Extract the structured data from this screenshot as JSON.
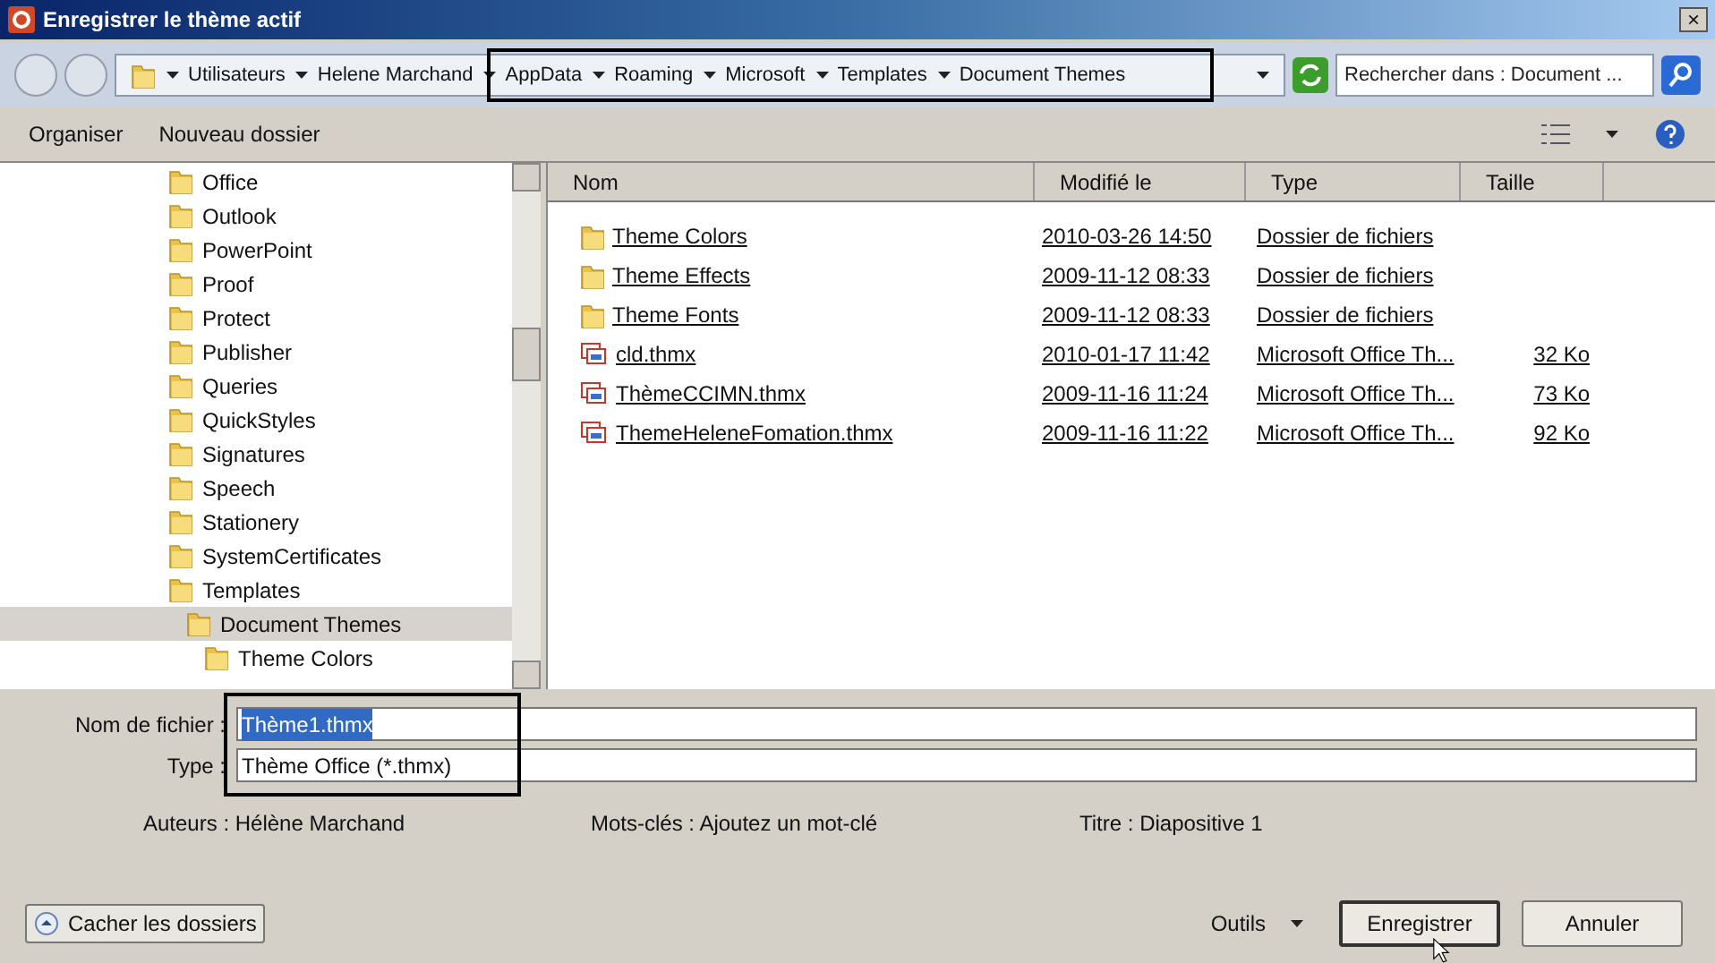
{
  "window": {
    "title": "Enregistrer le thème actif",
    "close": "×"
  },
  "breadcrumb": [
    {
      "label": "Utilisateurs"
    },
    {
      "label": "Helene Marchand"
    },
    {
      "label": "AppData"
    },
    {
      "label": "Roaming"
    },
    {
      "label": "Microsoft"
    },
    {
      "label": "Templates"
    },
    {
      "label": "Document Themes"
    }
  ],
  "search": {
    "placeholder": "Rechercher dans : Document ..."
  },
  "toolbar": {
    "organize": "Organiser",
    "new_folder": "Nouveau dossier"
  },
  "tree": [
    {
      "label": "Office",
      "selected": false
    },
    {
      "label": "Outlook",
      "selected": false
    },
    {
      "label": "PowerPoint",
      "selected": false
    },
    {
      "label": "Proof",
      "selected": false
    },
    {
      "label": "Protect",
      "selected": false
    },
    {
      "label": "Publisher",
      "selected": false
    },
    {
      "label": "Queries",
      "selected": false
    },
    {
      "label": "QuickStyles",
      "selected": false
    },
    {
      "label": "Signatures",
      "selected": false
    },
    {
      "label": "Speech",
      "selected": false
    },
    {
      "label": "Stationery",
      "selected": false
    },
    {
      "label": "SystemCertificates",
      "selected": false
    },
    {
      "label": "Templates",
      "selected": false,
      "children": [
        {
          "label": "Document Themes",
          "selected": true,
          "children": [
            {
              "label": "Theme Colors",
              "selected": false
            }
          ]
        }
      ]
    }
  ],
  "table": {
    "columns": [
      "Nom",
      "Modifié le",
      "Type",
      "Taille"
    ],
    "rows": [
      {
        "kind": "folder",
        "name": "Theme Colors",
        "modified": "2010-03-26 14:50",
        "type": "Dossier de fichiers"
      },
      {
        "kind": "folder",
        "name": "Theme Effects",
        "modified": "2009-11-12 08:33",
        "type": "Dossier de fichiers"
      },
      {
        "kind": "folder",
        "name": "Theme Fonts",
        "modified": "2009-11-12 08:33",
        "type": "Dossier de fichiers"
      },
      {
        "kind": "file",
        "name": "cld.thmx",
        "modified": "2010-01-17 11:42",
        "type": "Microsoft Office Th...",
        "size": "32 Ko"
      },
      {
        "kind": "file",
        "name": "ThèmeCCIMN.thmx",
        "modified": "2009-11-16 11:24",
        "type": "Microsoft Office Th...",
        "size": "73 Ko"
      },
      {
        "kind": "file",
        "name": "ThemeHeleneFomation.thmx",
        "modified": "2009-11-16 11:22",
        "type": "Microsoft Office Th...",
        "size": "92 Ko"
      }
    ]
  },
  "form": {
    "filename_label": "Nom de fichier :",
    "filename": "Thème1.thmx",
    "type_label": "Type :",
    "type": "Thème Office (*.thmx)"
  },
  "metadata": [
    {
      "label": "Auteurs :",
      "value": "Hélène Marchand"
    },
    {
      "label": "Mots-clés :",
      "value": "Ajoutez un mot-clé"
    },
    {
      "label": "Titre :",
      "value": "Diapositive 1"
    }
  ],
  "footer": {
    "hide_folders": "Cacher les dossiers",
    "tools": "Outils",
    "save": "Enregistrer",
    "cancel": "Annuler"
  }
}
